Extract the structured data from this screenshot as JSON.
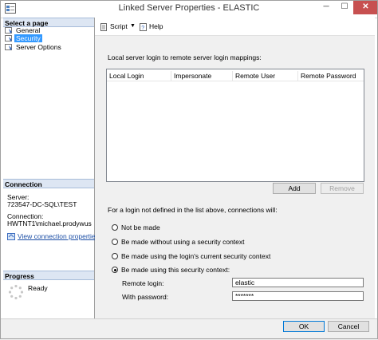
{
  "window": {
    "title": "Linked Server Properties - ELASTIC",
    "minimize": "─",
    "maximize": "☐",
    "close": "✕"
  },
  "left": {
    "select_page_header": "Select a page",
    "pages": [
      {
        "label": "General",
        "icon": "page-icon"
      },
      {
        "label": "Security",
        "icon": "page-icon",
        "selected": true
      },
      {
        "label": "Server Options",
        "icon": "page-icon"
      }
    ],
    "connection_header": "Connection",
    "server_label": "Server:",
    "server_value": "723547-DC-SQL\\TEST",
    "connection_label": "Connection:",
    "connection_value": "HWTNT1\\michael.prodywus",
    "view_connection_link": "View connection properties",
    "progress_header": "Progress",
    "progress_status": "Ready"
  },
  "toolbar": {
    "script_label": "Script",
    "help_label": "Help"
  },
  "main": {
    "mappings_label": "Local server login to remote server login mappings:",
    "grid_columns": [
      "Local Login",
      "Impersonate",
      "Remote User",
      "Remote Password"
    ],
    "add_label": "Add",
    "remove_label": "Remove",
    "undefined_login_label": "For a login not defined in the list above, connections will:",
    "options": [
      {
        "label": "Not be made",
        "selected": false
      },
      {
        "label": "Be made without using a security context",
        "selected": false
      },
      {
        "label": "Be made using the login's current security context",
        "selected": false
      },
      {
        "label": "Be made using this security context:",
        "selected": true
      }
    ],
    "remote_login_label": "Remote login:",
    "remote_login_value": "elastic",
    "password_label": "With password:",
    "password_value": "*******"
  },
  "footer": {
    "ok_label": "OK",
    "cancel_label": "Cancel"
  },
  "colors": {
    "selected_highlight": "#3399ff",
    "section_header_bg": "#dde6f3",
    "close_button_bg": "#c75050",
    "link": "#1d4fa6"
  }
}
